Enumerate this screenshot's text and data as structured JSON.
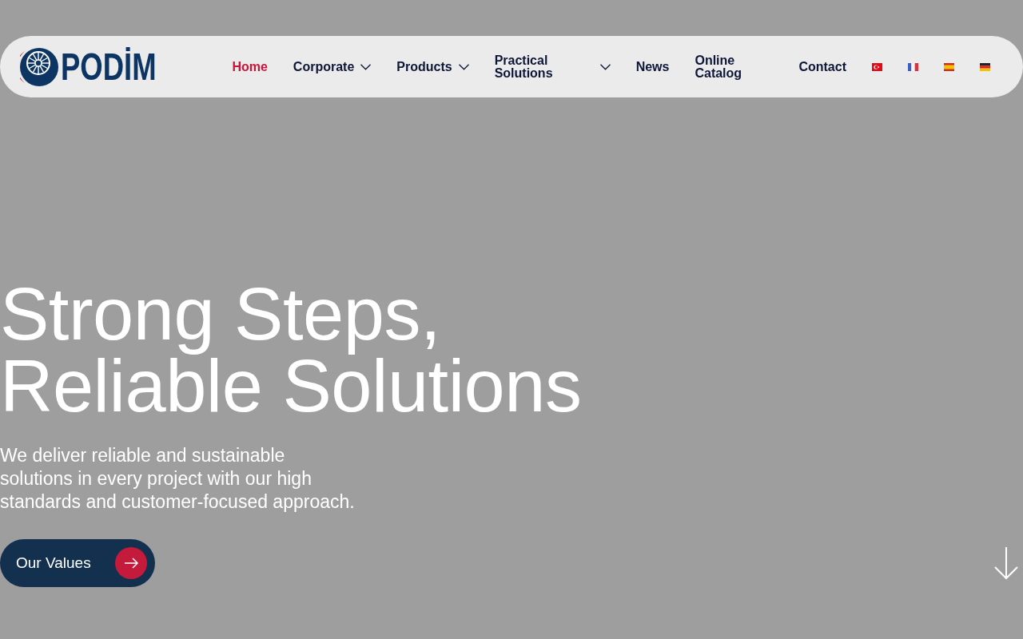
{
  "header": {
    "logo": {
      "text": "PODİM"
    },
    "nav": [
      {
        "label": "Home",
        "kind": "link",
        "selected": true
      },
      {
        "label": "Corporate",
        "kind": "dropdown",
        "selected": false
      },
      {
        "label": "Products",
        "kind": "dropdown",
        "selected": false
      },
      {
        "label": "Practical Solutions",
        "kind": "dropdown",
        "selected": false
      },
      {
        "label": "News",
        "kind": "link",
        "selected": false
      },
      {
        "label": "Online Catalog",
        "kind": "link",
        "selected": false
      },
      {
        "label": "Contact",
        "kind": "link",
        "selected": false
      }
    ],
    "languages": [
      {
        "kind": "tr"
      },
      {
        "kind": "fr"
      },
      {
        "kind": "es"
      },
      {
        "kind": "de"
      }
    ]
  },
  "hero": {
    "title": "Strong Steps, Reliable Solutions",
    "text": "We deliver reliable and sustainable solutions in every project with our high standards and customer-focused approach.",
    "button": {
      "label": "Our Values"
    }
  }
}
